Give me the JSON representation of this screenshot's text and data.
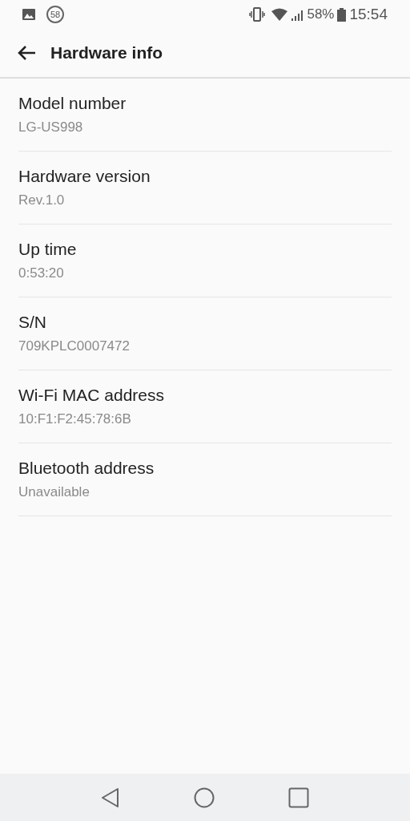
{
  "status_bar": {
    "notification_badge": "58",
    "battery": "58%",
    "time": "15:54"
  },
  "toolbar": {
    "title": "Hardware info"
  },
  "items": [
    {
      "title": "Model number",
      "value": "LG-US998"
    },
    {
      "title": "Hardware version",
      "value": "Rev.1.0"
    },
    {
      "title": "Up time",
      "value": "0:53:20"
    },
    {
      "title": "S/N",
      "value": "709KPLC0007472"
    },
    {
      "title": "Wi-Fi MAC address",
      "value": "10:F1:F2:45:78:6B"
    },
    {
      "title": "Bluetooth address",
      "value": "Unavailable"
    }
  ]
}
